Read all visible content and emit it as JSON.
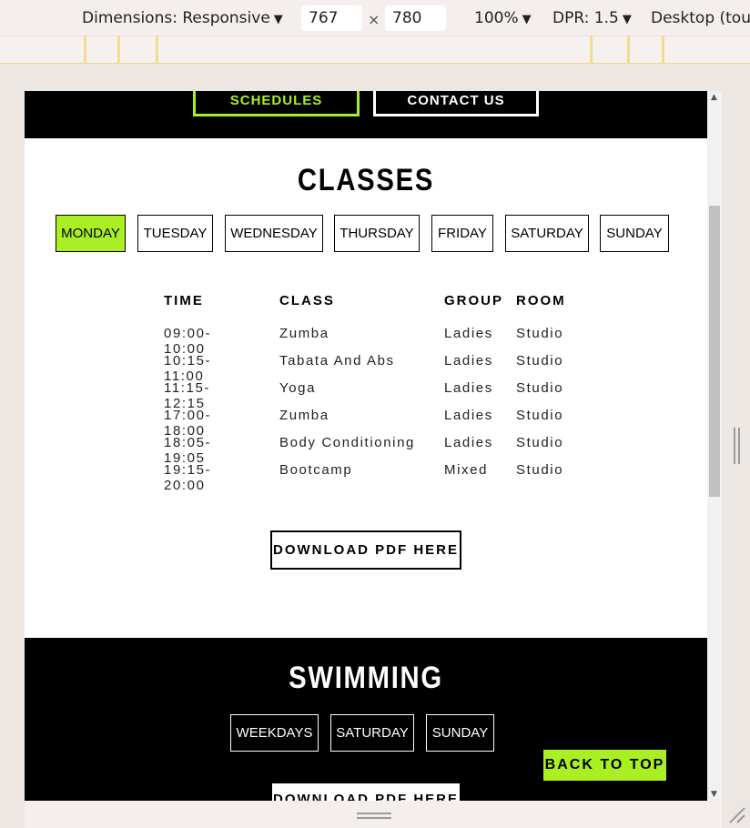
{
  "devtools": {
    "dimensions_label": "Dimensions: Responsive",
    "width_value": "767",
    "height_value": "780",
    "times": "×",
    "zoom": "100%",
    "dpr": "DPR: 1.5",
    "device_mode": "Desktop (touch)",
    "caret": "▼"
  },
  "nav": {
    "items": [
      {
        "label": "SCHEDULES",
        "active": true
      },
      {
        "label": "CONTACT US",
        "active": false
      }
    ]
  },
  "classes": {
    "title": "CLASSES",
    "days": [
      {
        "label": "MONDAY",
        "active": true
      },
      {
        "label": "TUESDAY",
        "active": false
      },
      {
        "label": "WEDNESDAY",
        "active": false
      },
      {
        "label": "THURSDAY",
        "active": false
      },
      {
        "label": "FRIDAY",
        "active": false
      },
      {
        "label": "SATURDAY",
        "active": false
      },
      {
        "label": "SUNDAY",
        "active": false
      }
    ],
    "columns": [
      "TIME",
      "CLASS",
      "GROUP",
      "ROOM"
    ],
    "rows": [
      [
        "09:00-10:00",
        "Zumba",
        "Ladies",
        "Studio"
      ],
      [
        "10:15-11:00",
        "Tabata And Abs",
        "Ladies",
        "Studio"
      ],
      [
        "11:15-12:15",
        "Yoga",
        "Ladies",
        "Studio"
      ],
      [
        "17:00-18:00",
        "Zumba",
        "Ladies",
        "Studio"
      ],
      [
        "18:05-19:05",
        "Body Conditioning",
        "Ladies",
        "Studio"
      ],
      [
        "19:15-20:00",
        "Bootcamp",
        "Mixed",
        "Studio"
      ]
    ],
    "download_label": "DOWNLOAD PDF HERE"
  },
  "swimming": {
    "title": "SWIMMING",
    "days": [
      "WEEKDAYS",
      "SATURDAY",
      "SUNDAY"
    ],
    "download_label": "DOWNLOAD PDF HERE"
  },
  "back_to_top": "BACK TO TOP",
  "colors": {
    "accent": "#a9ef23",
    "dark": "#000000",
    "light": "#ffffff"
  }
}
